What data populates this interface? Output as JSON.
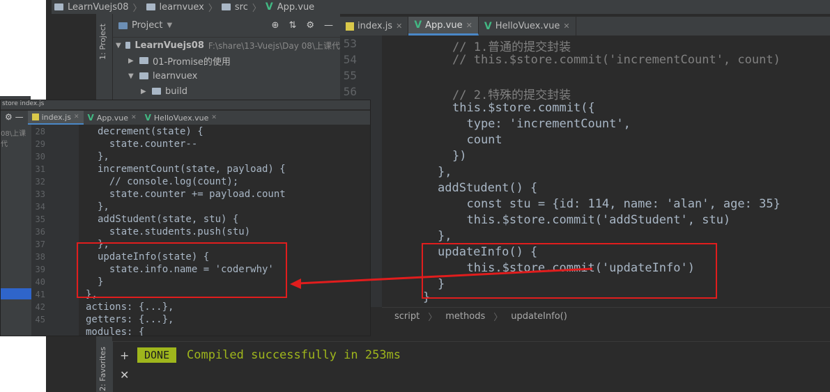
{
  "breadcrumb": [
    "LearnVuejs08",
    "learnvuex",
    "src",
    "App.vue"
  ],
  "sidebar_labels": {
    "project": "1: Project",
    "favorites": "2: Favorites"
  },
  "project_panel": {
    "title": "Project",
    "rows": [
      {
        "name": "LearnVuejs08",
        "hint": "F:\\share\\13-Vuejs\\Day 08\\上课代"
      },
      {
        "name": "01-Promise的使用",
        "hint": ""
      },
      {
        "name": "learnvuex",
        "hint": ""
      },
      {
        "name": "build",
        "hint": ""
      }
    ]
  },
  "main_tabs": [
    {
      "label": "index.js",
      "icon": "js-file-icon"
    },
    {
      "label": "App.vue",
      "icon": "vue-file-icon"
    },
    {
      "label": "HelloVuex.vue",
      "icon": "vue-file-icon"
    }
  ],
  "main_line_numbers": [
    "53",
    "54",
    "55",
    "56"
  ],
  "main_code": [
    "// 1.普通的提交封装",
    "// this.$store.commit('incrementCount', count)",
    "",
    "// 2.特殊的提交封装",
    "this.$store.commit({",
    "  type: 'incrementCount',",
    "  count",
    "})",
    "},",
    "addStudent() {",
    "  const stu = {id: 114, name: 'alan', age: 35}",
    "  this.$store.commit('addStudent', stu)",
    "},",
    "updateInfo() {",
    "  this.$store.commit('updateInfo')",
    "}",
    "}"
  ],
  "structure_path": [
    "script",
    "methods",
    "updateInfo()"
  ],
  "terminal": {
    "badge": "DONE",
    "message": "Compiled successfully in 253ms"
  },
  "overlay": {
    "top_crumb": "store   index.js",
    "side_hint": "08\\上课代",
    "tabs": [
      {
        "label": "index.js",
        "icon": "js-file-icon"
      },
      {
        "label": "App.vue",
        "icon": "vue-file-icon"
      },
      {
        "label": "HelloVuex.vue",
        "icon": "vue-file-icon"
      }
    ],
    "line_numbers": [
      "28",
      "29",
      "30",
      "31",
      "32",
      "33",
      "34",
      "35",
      "36",
      "37",
      "38",
      "39",
      "40",
      "41",
      "42",
      "45"
    ],
    "code": [
      "decrement(state) {",
      "  state.counter--",
      "},",
      "incrementCount(state, payload) {",
      "  // console.log(count);",
      "  state.counter += payload.count",
      "},",
      "addStudent(state, stu) {",
      "  state.students.push(stu)",
      "},",
      "updateInfo(state) {",
      "  state.info.name = 'coderwhy'",
      "}",
      "},",
      "actions: {...},",
      "getters: {...},",
      "modules: {"
    ]
  },
  "colors": {
    "accent_red": "#e11d1d",
    "done_green": "#9fb61c",
    "vue_green": "#42b883"
  }
}
